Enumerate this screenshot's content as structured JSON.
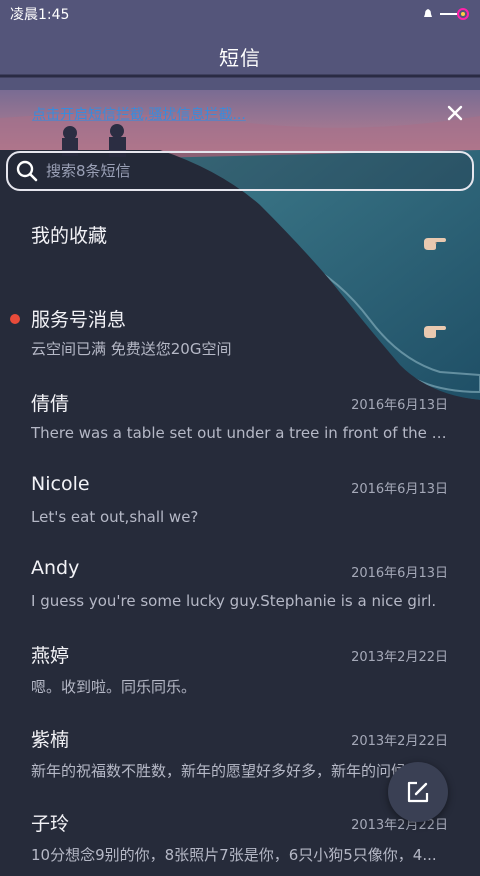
{
  "status": {
    "time": "凌晨1:45"
  },
  "header": {
    "title": "短信"
  },
  "banner": {
    "text": "点击开启短信拦截,骚扰信息拦截..."
  },
  "search": {
    "placeholder": "搜索8条短信"
  },
  "messages": [
    {
      "name": "我的收藏",
      "preview": "",
      "date": "",
      "icon": "pointing-hand-icon"
    },
    {
      "name": "服务号消息",
      "preview": "云空间已满 免费送您20G空间",
      "date": "",
      "icon": "pointing-hand-icon",
      "unread": true
    },
    {
      "name": "倩倩",
      "preview": "There was a table set out under a tree in front of the ho...",
      "date": "2016年6月13日"
    },
    {
      "name": "Nicole",
      "preview": "Let's eat out,shall we?",
      "date": "2016年6月13日"
    },
    {
      "name": "Andy",
      "preview": "I guess you're some lucky guy.Stephanie is a nice girl.",
      "date": "2016年6月13日"
    },
    {
      "name": "燕婷",
      "preview": "嗯。收到啦。同乐同乐。",
      "date": "2013年2月22日"
    },
    {
      "name": "紫楠",
      "preview": "新年的祝福数不胜数，新年的愿望好多好多，新年的问候...",
      "date": "2013年2月22日"
    },
    {
      "name": "子玲",
      "preview": "10分想念9别的你，8张照片7张是你，6只小狗5只像你，4...",
      "date": "2013年2月22日"
    }
  ],
  "colors": {
    "accent_link": "#3a8bdb",
    "unread_dot": "#e84b3a",
    "background": "#262b3a"
  }
}
